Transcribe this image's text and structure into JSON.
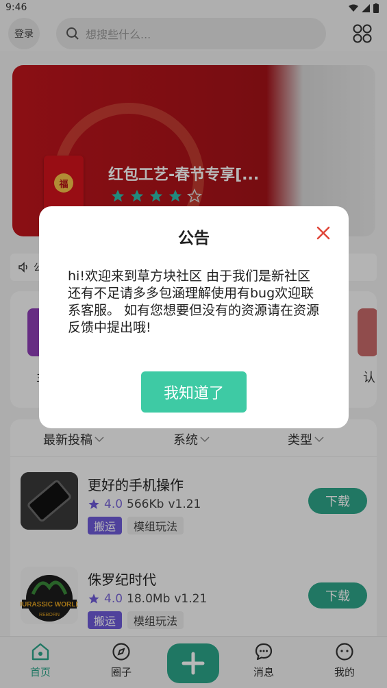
{
  "status_bar": {
    "time": "9:46"
  },
  "top_bar": {
    "login_label": "登录",
    "search_placeholder": "想搜些什么...",
    "grid_icon": "grid-icon"
  },
  "banner": {
    "packet_char": "福",
    "title": "红包工艺-春节专享[...",
    "rating_stars": 4,
    "rating_max": 5
  },
  "notice": {
    "text": "公"
  },
  "categories": {
    "left_label": "主",
    "right_label": "认"
  },
  "filters": [
    {
      "label": "最新投稿"
    },
    {
      "label": "系统"
    },
    {
      "label": "类型"
    }
  ],
  "list": [
    {
      "title": "更好的手机操作",
      "rating": "4.0",
      "size": "566Kb",
      "version": "v1.21",
      "tags": [
        "搬运",
        "模组玩法"
      ],
      "action": "下载"
    },
    {
      "title": "侏罗纪时代",
      "rating": "4.0",
      "size": "18.0Mb",
      "version": "v1.21",
      "tags": [
        "搬运",
        "模组玩法"
      ],
      "action": "下载",
      "thumb_text": "JURASSIC WORLD",
      "thumb_subtext": "REBORN"
    }
  ],
  "bottom_nav": {
    "home": "首页",
    "circle": "圈子",
    "messages": "消息",
    "mine": "我的"
  },
  "dialog": {
    "title": "公告",
    "body": "hi!欢迎来到草方块社区 由于我们是新社区还有不足请多多包涵理解使用有bug欢迎联系客服。 如有您想要但没有的资源请在资源反馈中提出哦!",
    "confirm_label": "我知道了"
  },
  "colors": {
    "accent": "#2ca58a",
    "dialog_button": "#3ecaa4",
    "tag_purple": "#6e5bd9",
    "close_red": "#e0473a"
  }
}
